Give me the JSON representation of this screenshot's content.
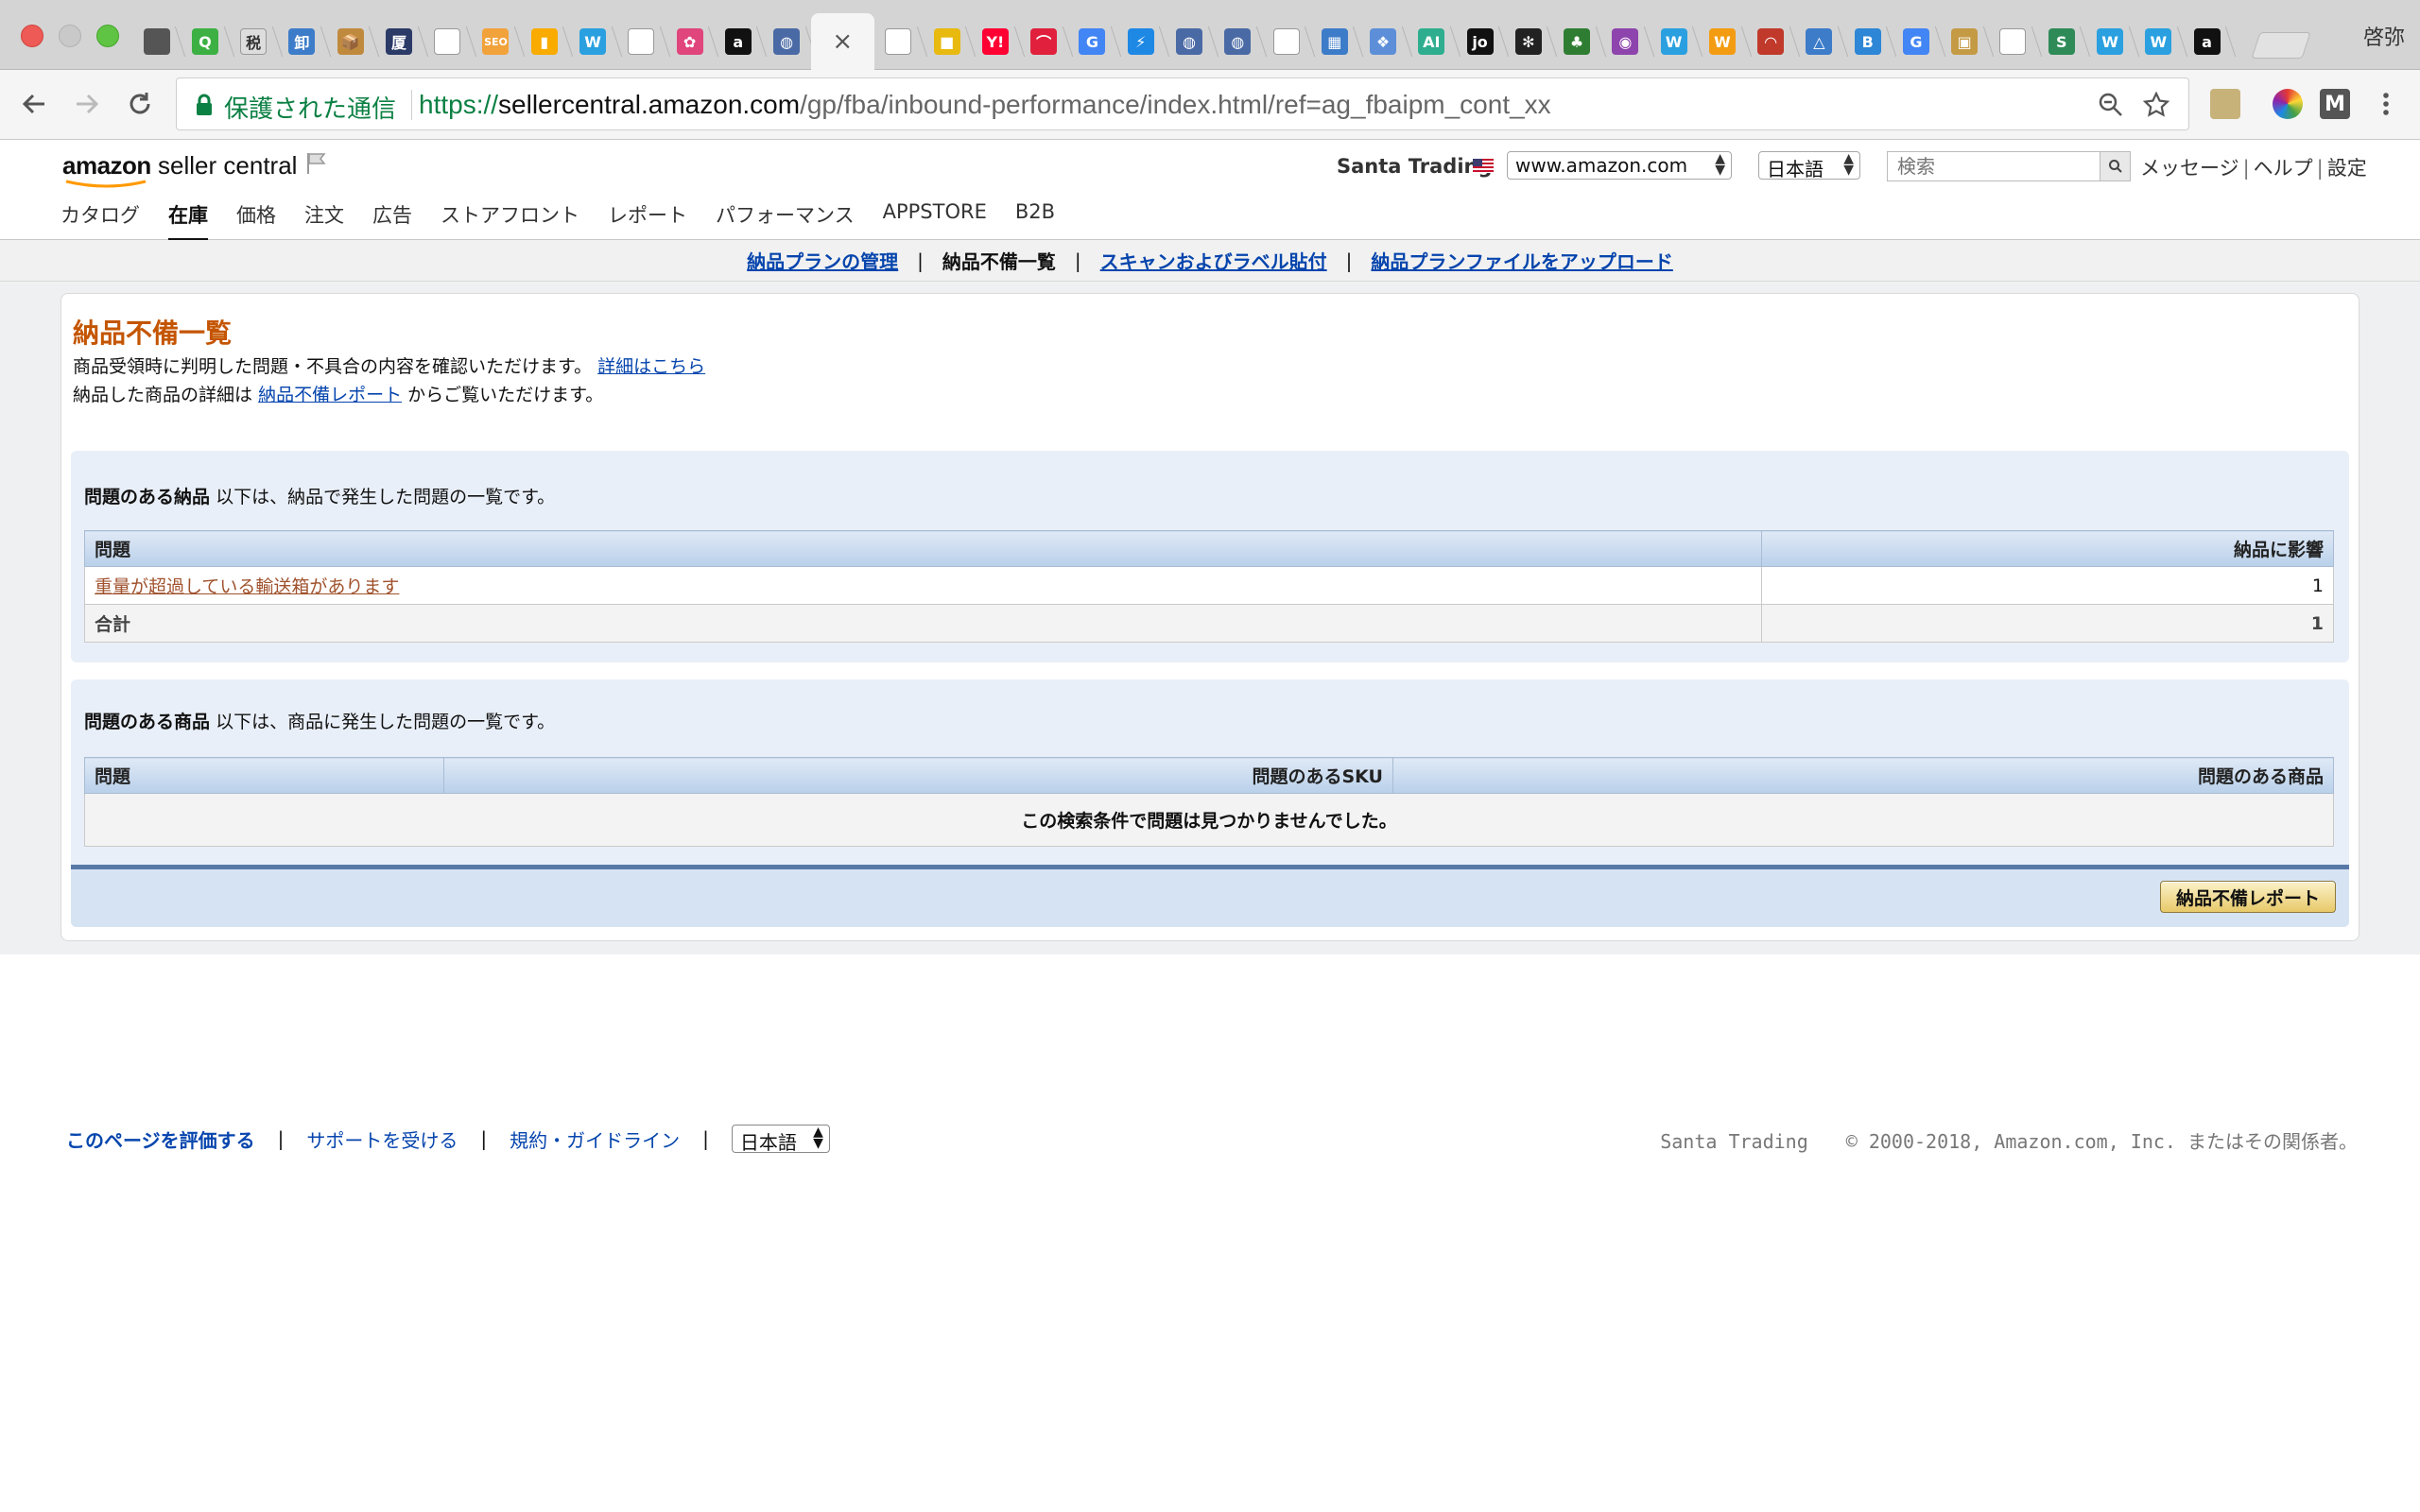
{
  "browser": {
    "profile_name": "啓弥",
    "secure_label": "保護された通信",
    "url_scheme": "https://",
    "url_host": "sellercentral.amazon.com",
    "url_path": "/gp/fba/inbound-performance/index.html/ref=ag_fbaipm_cont_xx",
    "tab_favicons": [
      {
        "icon": "apple-icon",
        "color": "#555555",
        "glyph": ""
      },
      {
        "icon": "green-q-icon",
        "color": "#3cb043",
        "glyph": "Q"
      },
      {
        "icon": "tag-icon",
        "color": "#dddddd",
        "glyph": "税"
      },
      {
        "icon": "blue-box-icon",
        "color": "#3d7cc9",
        "glyph": "卸"
      },
      {
        "icon": "box-icon",
        "color": "#c08a3e",
        "glyph": "📦"
      },
      {
        "icon": "navy-square-icon",
        "color": "#2b3a67",
        "glyph": "厦"
      },
      {
        "icon": "page-icon",
        "color": "#ffffff",
        "glyph": ""
      },
      {
        "icon": "seo-icon",
        "color": "#f2a23a",
        "glyph": "SEO"
      },
      {
        "icon": "analytics-icon",
        "color": "#f9ab00",
        "glyph": "▮"
      },
      {
        "icon": "w-icon",
        "color": "#2aa0e0",
        "glyph": "W"
      },
      {
        "icon": "blank-icon",
        "color": "#ffffff",
        "glyph": ""
      },
      {
        "icon": "flower-icon",
        "color": "#e0457b",
        "glyph": "✿"
      },
      {
        "icon": "amazon-a-icon",
        "color": "#111111",
        "glyph": "a"
      },
      {
        "icon": "globe-icon",
        "color": "#4a6aa5",
        "glyph": "◍"
      },
      {
        "icon": "page-icon",
        "color": "#ffffff",
        "glyph": ""
      },
      {
        "icon": "yellow-icon",
        "color": "#e8b90f",
        "glyph": "■"
      },
      {
        "icon": "yahoo-icon",
        "color": "#ff0033",
        "glyph": "Y!"
      },
      {
        "icon": "red-icon",
        "color": "#e0203c",
        "glyph": "⌒"
      },
      {
        "icon": "google-icon",
        "color": "#4285f4",
        "glyph": "G"
      },
      {
        "icon": "bolt-icon",
        "color": "#1e88e5",
        "glyph": "⚡"
      },
      {
        "icon": "globe-icon",
        "color": "#4a6aa5",
        "glyph": "◍"
      },
      {
        "icon": "globe-icon",
        "color": "#4a6aa5",
        "glyph": "◍"
      },
      {
        "icon": "page-icon",
        "color": "#ffffff",
        "glyph": ""
      },
      {
        "icon": "grid-icon",
        "color": "#3d7cc9",
        "glyph": "▦"
      },
      {
        "icon": "bird-icon",
        "color": "#5d8fd9",
        "glyph": "❖"
      },
      {
        "icon": "ai-icon",
        "color": "#2eae8f",
        "glyph": "AI"
      },
      {
        "icon": "jo-icon",
        "color": "#111111",
        "glyph": "jo"
      },
      {
        "icon": "panda-icon",
        "color": "#222222",
        "glyph": "✻"
      },
      {
        "icon": "tree-icon",
        "color": "#2f7d32",
        "glyph": "♣"
      },
      {
        "icon": "color-wheel-icon",
        "color": "#8e44ad",
        "glyph": "◉"
      },
      {
        "icon": "w-icon",
        "color": "#2aa0e0",
        "glyph": "W"
      },
      {
        "icon": "wp-icon",
        "color": "#f39c12",
        "glyph": "W"
      },
      {
        "icon": "fan-icon",
        "color": "#c0392b",
        "glyph": "◠"
      },
      {
        "icon": "triangle-icon",
        "color": "#3d7cc9",
        "glyph": "△"
      },
      {
        "icon": "b-icon",
        "color": "#2d86d6",
        "glyph": "B"
      },
      {
        "icon": "google-icon",
        "color": "#4285f4",
        "glyph": "G"
      },
      {
        "icon": "image-icon",
        "color": "#c49a45",
        "glyph": "▣"
      },
      {
        "icon": "page-icon",
        "color": "#ffffff",
        "glyph": ""
      },
      {
        "icon": "s-icon",
        "color": "#2e8b57",
        "glyph": "S"
      },
      {
        "icon": "w-icon",
        "color": "#2aa0e0",
        "glyph": "W"
      },
      {
        "icon": "w-icon",
        "color": "#2aa0e0",
        "glyph": "W"
      },
      {
        "icon": "amazon-a-icon",
        "color": "#111111",
        "glyph": "a"
      }
    ]
  },
  "header": {
    "logo_brand": "amazon",
    "logo_product": "seller central",
    "merchant_name": "Santa Trading",
    "marketplace": "www.amazon.com",
    "language": "日本語",
    "search_placeholder": "検索",
    "links": [
      "メッセージ",
      "ヘルプ",
      "設定"
    ]
  },
  "main_nav": [
    {
      "label": "カタログ",
      "active": false
    },
    {
      "label": "在庫",
      "active": true
    },
    {
      "label": "価格",
      "active": false
    },
    {
      "label": "注文",
      "active": false
    },
    {
      "label": "広告",
      "active": false
    },
    {
      "label": "ストアフロント",
      "active": false
    },
    {
      "label": "レポート",
      "active": false
    },
    {
      "label": "パフォーマンス",
      "active": false
    },
    {
      "label": "APPSTORE",
      "active": false
    },
    {
      "label": "B2B",
      "active": false
    }
  ],
  "sub_nav": {
    "manage_plans": "納品プランの管理",
    "current": "納品不備一覧",
    "scan_label": "スキャンおよびラベル貼付",
    "upload": "納品プランファイルをアップロード",
    "separator": "|"
  },
  "page": {
    "title": "納品不備一覧",
    "desc1": "商品受領時に判明した問題・不具合の内容を確認いただけます。",
    "desc1_link": "詳細はこちら",
    "desc2_prefix": "納品した商品の詳細は",
    "desc2_link": "納品不備レポート",
    "desc2_suffix": "からご覧いただけます。"
  },
  "shipments_section": {
    "title_bold": "問題のある納品",
    "title_rest": "以下は、納品で発生した問題の一覧です。",
    "columns": [
      "問題",
      "納品に影響"
    ],
    "rows": [
      {
        "issue": "重量が超過している輸送箱があります",
        "count": "1"
      }
    ],
    "total_label": "合計",
    "total_value": "1"
  },
  "products_section": {
    "title_bold": "問題のある商品",
    "title_rest": "以下は、商品に発生した問題の一覧です。",
    "columns": [
      "問題",
      "問題のあるSKU",
      "問題のある商品"
    ],
    "empty_message": "この検索条件で問題は見つかりませんでした。"
  },
  "report_button": "納品不備レポート",
  "footer": {
    "rate_page": "このページを評価する",
    "support": "サポートを受ける",
    "terms": "規約・ガイドライン",
    "language": "日本語",
    "separator": "|",
    "merchant": "Santa Trading",
    "copyright": "© 2000-2018, Amazon.com, Inc. またはその関係者。"
  },
  "colors": {
    "title_orange": "#c45500",
    "link_blue": "#0645ad",
    "issue_link": "#a0522d",
    "section_bg": "#e9eff8",
    "secure_green": "#0b8043"
  }
}
